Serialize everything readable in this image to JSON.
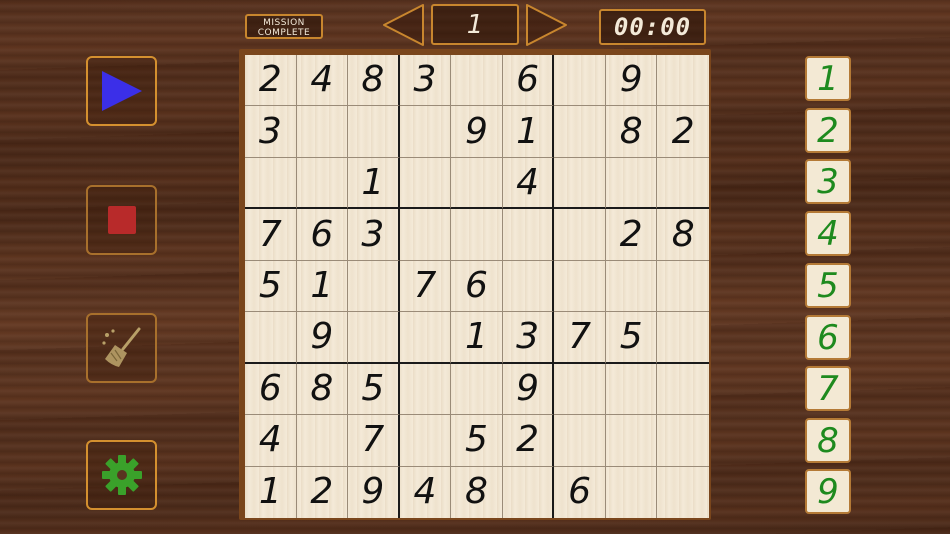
{
  "header": {
    "mission_line1": "MISSION",
    "mission_line2": "COMPLETE",
    "level": "1",
    "timer": "00:00"
  },
  "icons": {
    "prev": "left-arrow-icon",
    "next": "right-arrow-icon",
    "play": "play-icon",
    "stop": "stop-icon",
    "clear": "broom-icon",
    "settings": "gear-icon"
  },
  "colors": {
    "play": "#3b2fe8",
    "stop": "#b82a2a",
    "settings": "#3aa12a",
    "number_pad_text": "#1e8a1e",
    "accent_border": "#c8862e"
  },
  "board": [
    [
      "2",
      "4",
      "8",
      "3",
      "",
      "6",
      "",
      "9",
      ""
    ],
    [
      "3",
      "",
      "",
      "",
      "9",
      "1",
      "",
      "8",
      "2"
    ],
    [
      "",
      "",
      "1",
      "",
      "",
      "4",
      "",
      "",
      ""
    ],
    [
      "7",
      "6",
      "3",
      "",
      "",
      "",
      "",
      "2",
      "8"
    ],
    [
      "5",
      "1",
      "",
      "7",
      "6",
      "",
      "",
      "",
      ""
    ],
    [
      "",
      "9",
      "",
      "",
      "1",
      "3",
      "7",
      "5",
      ""
    ],
    [
      "6",
      "8",
      "5",
      "",
      "",
      "9",
      "",
      "",
      ""
    ],
    [
      "4",
      "",
      "7",
      "",
      "5",
      "2",
      "",
      "",
      ""
    ],
    [
      "1",
      "2",
      "9",
      "4",
      "8",
      "",
      "6",
      "",
      ""
    ]
  ],
  "number_pad": [
    "1",
    "2",
    "3",
    "4",
    "5",
    "6",
    "7",
    "8",
    "9"
  ]
}
